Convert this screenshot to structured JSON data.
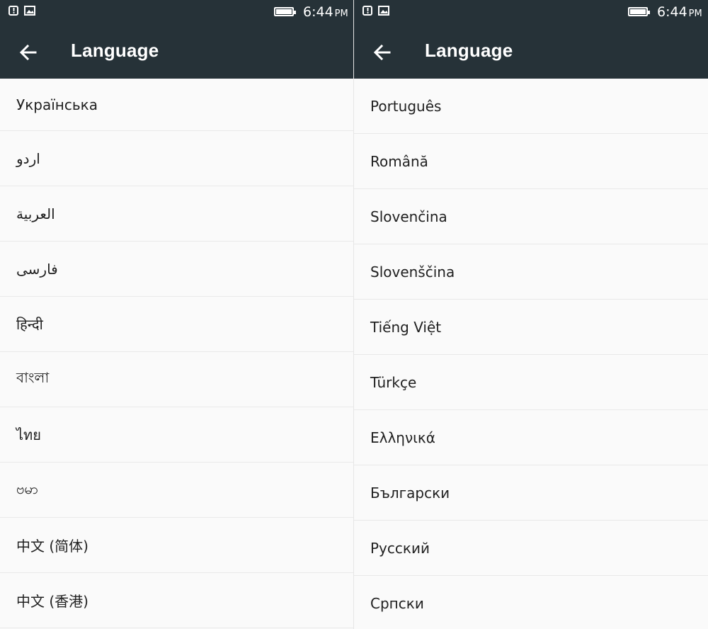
{
  "status": {
    "time": "6:44",
    "ampm": "PM",
    "icons": [
      "alert-icon",
      "image-icon",
      "battery-icon"
    ]
  },
  "left_screen": {
    "title": "Language",
    "items": [
      {
        "label": "Українська"
      },
      {
        "label": "اردو"
      },
      {
        "label": "العربية"
      },
      {
        "label": "فارسی"
      },
      {
        "label": "हिन्दी"
      },
      {
        "label": "বাংলা"
      },
      {
        "label": "ไทย"
      },
      {
        "label": "ဗမာ"
      },
      {
        "label": "中文 (简体)"
      },
      {
        "label": "中文 (香港)"
      }
    ]
  },
  "right_screen": {
    "title": "Language",
    "items": [
      {
        "label": "Português"
      },
      {
        "label": "Română"
      },
      {
        "label": "Slovenčina"
      },
      {
        "label": "Slovenščina"
      },
      {
        "label": "Tiếng Việt"
      },
      {
        "label": "Türkçe"
      },
      {
        "label": "Ελληνικά"
      },
      {
        "label": "Български"
      },
      {
        "label": "Русский"
      },
      {
        "label": "Српски"
      }
    ]
  }
}
